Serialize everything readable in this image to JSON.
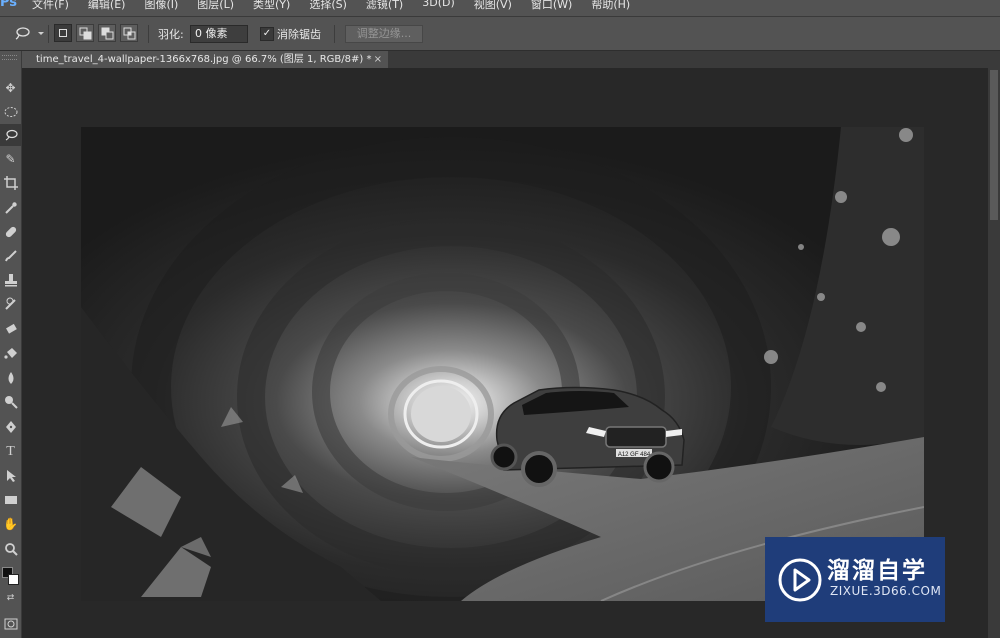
{
  "app": {
    "logo": "Ps"
  },
  "menu": [
    "文件(F)",
    "编辑(E)",
    "图像(I)",
    "图层(L)",
    "类型(Y)",
    "选择(S)",
    "滤镜(T)",
    "3D(D)",
    "视图(V)",
    "窗口(W)",
    "帮助(H)"
  ],
  "options": {
    "feather_label": "羽化:",
    "feather_value": "0 像素",
    "antialias_label": "消除锯齿",
    "antialias_checked": true,
    "refine_edge_label": "调整边缘..."
  },
  "document": {
    "tab_label": "time_travel_4-wallpaper-1366x768.jpg @ 66.7% (图层 1, RGB/8#) *",
    "close_glyph": "×"
  },
  "image": {
    "description_hidden": true,
    "plate": "A12 GF 484"
  },
  "watermark": {
    "title": "溜溜自学",
    "subtitle": "ZIXUE.3D66.COM"
  },
  "colors": {
    "ui_dark": "#535353",
    "workspace": "#282828",
    "watermark_bg": "#1f3d7a"
  }
}
